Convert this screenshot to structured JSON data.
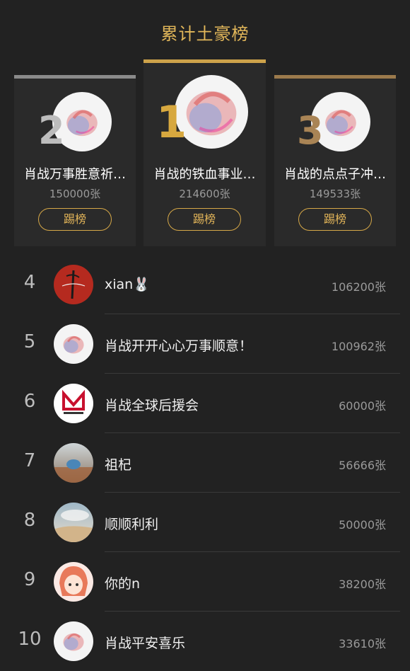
{
  "header": {
    "title": "累计土豪榜"
  },
  "podium": [
    {
      "rank": "2",
      "name": "肖战万事胜意祈…",
      "count": "150000张",
      "button": "踢榜"
    },
    {
      "rank": "1",
      "name": "肖战的铁血事业…",
      "count": "214600张",
      "button": "踢榜"
    },
    {
      "rank": "3",
      "name": "肖战的点点子冲…",
      "count": "149533张",
      "button": "踢榜"
    }
  ],
  "list": [
    {
      "rank": "4",
      "name": "xian🐰",
      "count": "106200张"
    },
    {
      "rank": "5",
      "name": "肖战开开心心万事顺意！",
      "count": "100962张"
    },
    {
      "rank": "6",
      "name": "肖战全球后援会",
      "count": "60000张"
    },
    {
      "rank": "7",
      "name": "祖杞",
      "count": "56666张"
    },
    {
      "rank": "8",
      "name": "顺顺利利",
      "count": "50000张"
    },
    {
      "rank": "9",
      "name": "你的n",
      "count": "38200张"
    },
    {
      "rank": "10",
      "name": "肖战平安喜乐",
      "count": "33610张"
    }
  ],
  "colors": {
    "accent": "#d6a848",
    "background": "#222222",
    "gold": "#cda24a",
    "silver": "#8a8a8a",
    "bronze": "#9b7a4c"
  },
  "icons": {
    "avatar_heart": "heart-avatar-icon"
  }
}
